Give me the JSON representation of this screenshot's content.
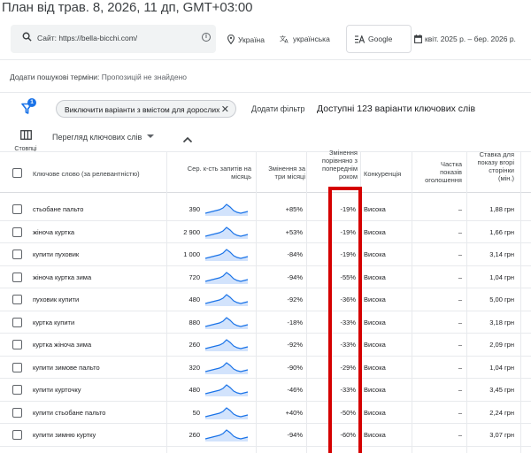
{
  "title": "План від трав. 8, 2026, 11 дп, GMT+03:00",
  "filters": {
    "site": "Сайт: https://bella-bicchi.com/",
    "location": "Україна",
    "language": "українська",
    "engine": "Google",
    "date_range": "квіт. 2025 р. – бер. 2026 р."
  },
  "add_terms": {
    "label": "Додати пошукові терміни:",
    "value": "Пропозицій не знайдено"
  },
  "toolbar": {
    "filter_badge": "1",
    "chip": "Виключити варіанти з вмістом для дорослих",
    "add_filter": "Додати фільтр",
    "available": "Доступні 123 варіанти ключових слів",
    "columns": "Стовпці",
    "view": "Перегляд ключових слів"
  },
  "columns": {
    "keyword": "Ключове слово (за релевантністю)",
    "searches_1": "Сер. к-сть запитів на",
    "searches_2": "місяць",
    "trend_1": "Змінення за",
    "trend_2": "три місяці",
    "yoy_1": "Змінення",
    "yoy_2": "порівняно з",
    "yoy_3": "попереднім",
    "yoy_4": "роком",
    "competition": "Конкуренція",
    "share_1": "Частка",
    "share_2": "показів",
    "share_3": "оголошення",
    "bid_1": "Ставка для",
    "bid_2": "показу вгорі",
    "bid_3": "сторінки",
    "bid_4": "(мін.)"
  },
  "rows": [
    {
      "keyword": "стьобане пальто",
      "searches": "390",
      "trend": "+85%",
      "yoy": "-19%",
      "competition": "Висока",
      "share": "–",
      "bid": "1,88 грн"
    },
    {
      "keyword": "жіноча куртка",
      "searches": "2 900",
      "trend": "+53%",
      "yoy": "-19%",
      "competition": "Висока",
      "share": "–",
      "bid": "1,66 грн"
    },
    {
      "keyword": "купити пуховик",
      "searches": "1 000",
      "trend": "-84%",
      "yoy": "-19%",
      "competition": "Висока",
      "share": "–",
      "bid": "3,14 грн"
    },
    {
      "keyword": "жіноча куртка зима",
      "searches": "720",
      "trend": "-94%",
      "yoy": "-55%",
      "competition": "Висока",
      "share": "–",
      "bid": "1,04 грн"
    },
    {
      "keyword": "пуховик купити",
      "searches": "480",
      "trend": "-92%",
      "yoy": "-36%",
      "competition": "Висока",
      "share": "–",
      "bid": "5,00 грн"
    },
    {
      "keyword": "куртка купити",
      "searches": "880",
      "trend": "-18%",
      "yoy": "-33%",
      "competition": "Висока",
      "share": "–",
      "bid": "3,18 грн"
    },
    {
      "keyword": "куртка жіноча зима",
      "searches": "260",
      "trend": "-92%",
      "yoy": "-33%",
      "competition": "Висока",
      "share": "–",
      "bid": "2,09 грн"
    },
    {
      "keyword": "купити зимове пальто",
      "searches": "320",
      "trend": "-90%",
      "yoy": "-29%",
      "competition": "Висока",
      "share": "–",
      "bid": "1,04 грн"
    },
    {
      "keyword": "купити курточку",
      "searches": "480",
      "trend": "-46%",
      "yoy": "-33%",
      "competition": "Висока",
      "share": "–",
      "bid": "3,45 грн"
    },
    {
      "keyword": "купити стьобане пальто",
      "searches": "50",
      "trend": "+40%",
      "yoy": "-50%",
      "competition": "Висока",
      "share": "–",
      "bid": "2,24 грн"
    },
    {
      "keyword": "купити зимню куртку",
      "searches": "260",
      "trend": "-94%",
      "yoy": "-60%",
      "competition": "Висока",
      "share": "–",
      "bid": "3,07 грн"
    }
  ],
  "colors": {
    "accent": "#1a73e8",
    "sparkline": "#1a73e8",
    "highlight": "#d50000"
  }
}
